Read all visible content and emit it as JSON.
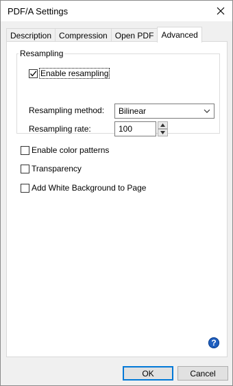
{
  "window": {
    "title": "PDF/A Settings",
    "close_icon": "close-icon"
  },
  "tabs": [
    {
      "label": "Description"
    },
    {
      "label": "Compression"
    },
    {
      "label": "Open PDF"
    },
    {
      "label": "Advanced",
      "selected": true
    }
  ],
  "resampling": {
    "group_label": "Resampling",
    "enable_label": "Enable resampling",
    "enable_checked": true,
    "method_label": "Resampling method:",
    "method_value": "Bilinear",
    "rate_label": "Resampling rate:",
    "rate_value": "100"
  },
  "options": [
    {
      "label": "Enable color patterns",
      "checked": false
    },
    {
      "label": "Transparency",
      "checked": false
    },
    {
      "label": "Add White Background to Page",
      "checked": false
    }
  ],
  "help": {
    "glyph": "?"
  },
  "buttons": {
    "ok": "OK",
    "cancel": "Cancel"
  },
  "colors": {
    "accent": "#0078d7",
    "help": "#1f5fbf"
  }
}
